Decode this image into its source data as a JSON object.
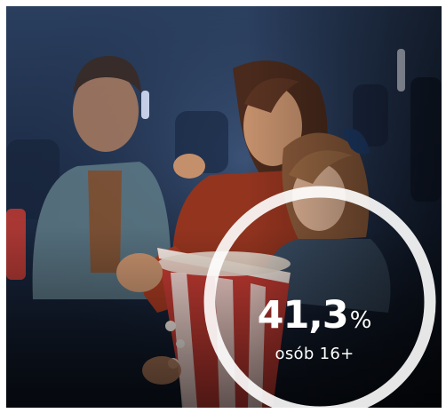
{
  "stat": {
    "value": "41,3",
    "unit": "%",
    "label": "osób 16+"
  },
  "colors": {
    "ring": "#ffffff",
    "text": "#ffffff",
    "popcorn_red": "#c23a32",
    "background_dark": "#142030"
  },
  "image": {
    "subject": "family-watching-movie-in-cinema-with-popcorn"
  }
}
